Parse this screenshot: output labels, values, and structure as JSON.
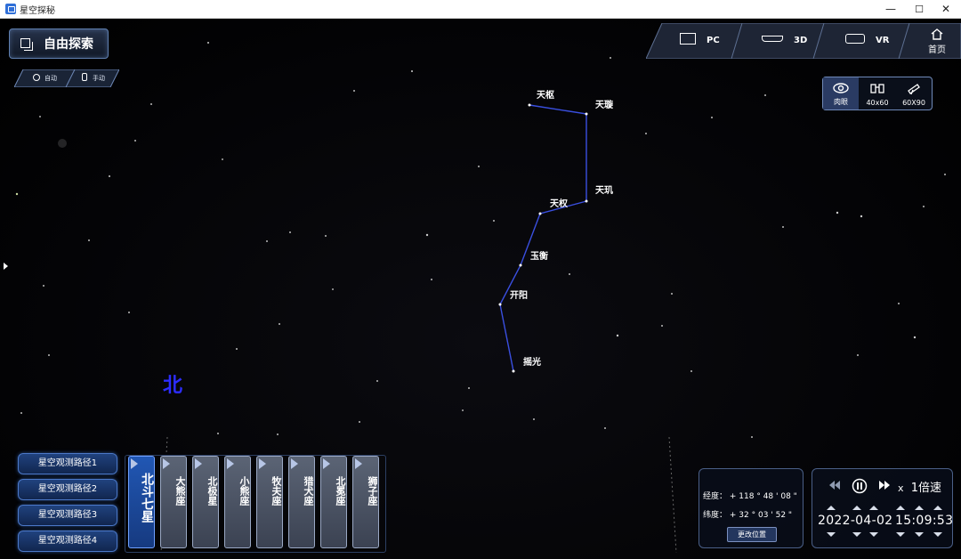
{
  "window": {
    "title": "星空探秘",
    "minimize": "—",
    "maximize": "☐",
    "close": "✕"
  },
  "explore_button": {
    "label": "自由探索",
    "icon": "layers-icon"
  },
  "modes": [
    {
      "label": "自动",
      "icon": "location-icon"
    },
    {
      "label": "手动",
      "icon": "hand-icon"
    }
  ],
  "top_nav": [
    {
      "label": "PC",
      "icon": "monitor-icon"
    },
    {
      "label": "3D",
      "icon": "3d-glasses-icon"
    },
    {
      "label": "VR",
      "icon": "vr-headset-icon"
    }
  ],
  "home": {
    "label": "首页",
    "icon": "home-icon"
  },
  "view_options": [
    {
      "label": "肉眼",
      "icon": "eye-icon",
      "active": true
    },
    {
      "label": "40x60",
      "icon": "binoculars-icon",
      "active": false
    },
    {
      "label": "60X90",
      "icon": "telescope-icon",
      "active": false
    }
  ],
  "constellation": {
    "stars": [
      "天枢",
      "天璇",
      "天玑",
      "天权",
      "玉衡",
      "开阳",
      "摇光"
    ]
  },
  "direction_label": "北",
  "routes": [
    "星空观测路径1",
    "星空观测路径2",
    "星空观测路径3",
    "星空观测路径4"
  ],
  "constellations": [
    "北斗七星",
    "大熊座",
    "北极星",
    "小熊座",
    "牧夫座",
    "猎犬座",
    "北冕座",
    "狮子座"
  ],
  "location": {
    "longitude_label": "经度：",
    "longitude_value": "+  118 ° 48 ' 08 \"",
    "latitude_label": "纬度：",
    "latitude_value": "+  32 ° 03 ' 52 \"",
    "change_button": "更改位置"
  },
  "time": {
    "speed_prefix": "x",
    "speed": "1倍速",
    "date": "2022-04-02",
    "clock": "15:09:53",
    "rewind_icon": "rewind-icon",
    "pause_icon": "pause-icon",
    "forward_icon": "fast-forward-icon"
  },
  "colors": {
    "accent": "#2157b4",
    "constellation_line": "#3a4fe0",
    "north": "#2d2dff"
  }
}
